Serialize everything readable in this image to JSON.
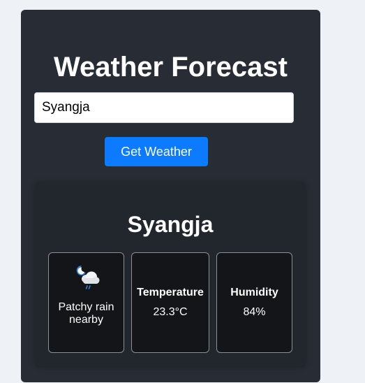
{
  "app": {
    "title": "Weather Forecast"
  },
  "search": {
    "value": "Syangja",
    "button_label": "Get Weather"
  },
  "result": {
    "city": "Syangja",
    "condition": {
      "icon": "patchy-rain-night-icon",
      "text": "Patchy rain nearby"
    },
    "temperature": {
      "label": "Temperature",
      "value": "23.3°C"
    },
    "humidity": {
      "label": "Humidity",
      "value": "84%"
    }
  }
}
